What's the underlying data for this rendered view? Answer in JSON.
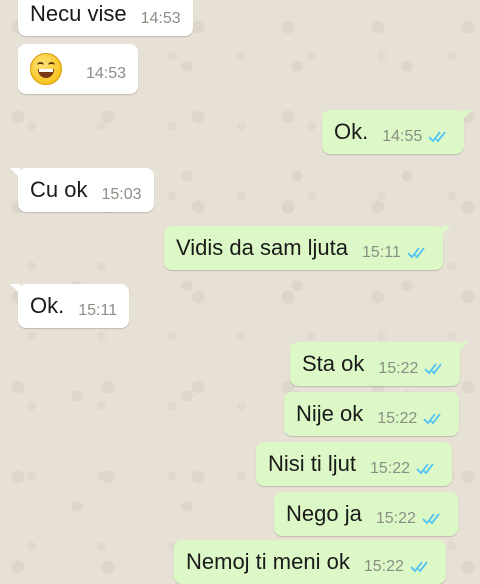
{
  "colors": {
    "incoming_bubble": "#ffffff",
    "outgoing_bubble": "#dcf8c6",
    "read_ticks": "#4fc3f7",
    "time_text": "#8a8f86"
  },
  "messages": [
    {
      "direction": "incoming",
      "text": "Necu vise",
      "time": "14:53"
    },
    {
      "direction": "incoming",
      "emoji": "grinning-face-icon",
      "time": "14:53"
    },
    {
      "direction": "outgoing",
      "text": "Ok.",
      "time": "14:55",
      "status": "read"
    },
    {
      "direction": "incoming",
      "text": "Cu ok",
      "time": "15:03"
    },
    {
      "direction": "outgoing",
      "text": "Vidis da sam ljuta",
      "time": "15:11",
      "status": "read"
    },
    {
      "direction": "incoming",
      "text": "Ok.",
      "time": "15:11"
    },
    {
      "direction": "outgoing",
      "text": "Sta ok",
      "time": "15:22",
      "status": "read"
    },
    {
      "direction": "outgoing",
      "text": "Nije ok",
      "time": "15:22",
      "status": "read"
    },
    {
      "direction": "outgoing",
      "text": "Nisi ti ljut",
      "time": "15:22",
      "status": "read"
    },
    {
      "direction": "outgoing",
      "text": "Nego ja",
      "time": "15:22",
      "status": "read"
    },
    {
      "direction": "outgoing",
      "text": "Nemoj ti meni ok",
      "time": "15:22",
      "status": "read"
    }
  ]
}
